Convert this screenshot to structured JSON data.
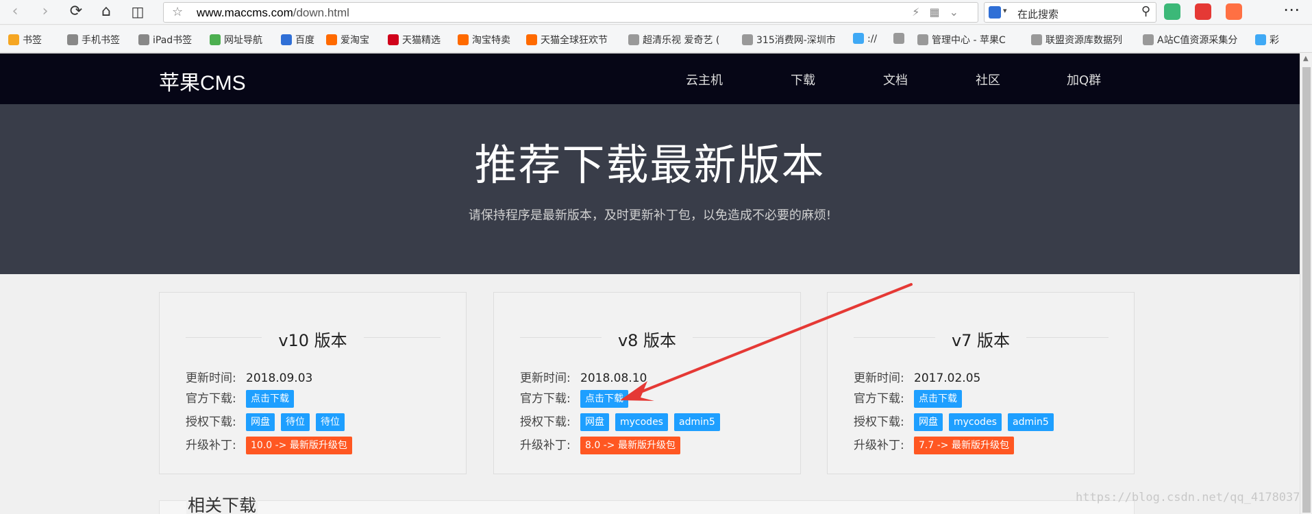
{
  "browser": {
    "url_host": "www.maccms.com",
    "url_path": "/down.html",
    "search_placeholder": "在此搜索",
    "bookmarks": [
      {
        "label": "书签",
        "color": "#f5a623"
      },
      {
        "label": "手机书签",
        "color": "#888888"
      },
      {
        "label": "iPad书签",
        "color": "#888888"
      },
      {
        "label": "网址导航",
        "color": "#4caf50"
      },
      {
        "label": "百度",
        "color": "#2f6fd6"
      },
      {
        "label": "爱淘宝",
        "color": "#ff6a00"
      },
      {
        "label": "天猫精选",
        "color": "#d0021b"
      },
      {
        "label": "淘宝特卖",
        "color": "#ff6a00"
      },
      {
        "label": "天猫全球狂欢节",
        "color": "#ff6a00"
      },
      {
        "label": "超清乐视 爱奇艺 (",
        "color": "#999999"
      },
      {
        "label": "315消费网-深圳市",
        "color": "#999999"
      },
      {
        "label": "://",
        "color": "#3fa9f5"
      },
      {
        "label": "",
        "color": "#999999"
      },
      {
        "label": "管理中心 - 苹果C",
        "color": "#999999"
      },
      {
        "label": "联盟资源库数据列",
        "color": "#999999"
      },
      {
        "label": "A站C值资源采集分",
        "color": "#999999"
      },
      {
        "label": "彩",
        "color": "#3fa9f5"
      }
    ]
  },
  "site": {
    "logo": "苹果CMS",
    "nav": [
      "云主机",
      "下载",
      "文档",
      "社区",
      "加Q群"
    ],
    "hero_title": "推荐下载最新版本",
    "hero_subtitle": "请保持程序是最新版本，及时更新补丁包，以免造成不必要的麻烦!"
  },
  "labels": {
    "update_time": "更新时间:",
    "official_download": "官方下载:",
    "licensed_download": "授权下载:",
    "upgrade_patch": "升级补丁:"
  },
  "cards": [
    {
      "title": "v10 版本",
      "date": "2018.09.03",
      "official_btn": "点击下载",
      "licensed_btns": [
        "网盘",
        "待位",
        "待位"
      ],
      "patch_btn": "10.0 -> 最新版升级包"
    },
    {
      "title": "v8 版本",
      "date": "2018.08.10",
      "official_btn": "点击下载",
      "licensed_btns": [
        "网盘",
        "mycodes",
        "admin5"
      ],
      "patch_btn": "8.0 -> 最新版升级包"
    },
    {
      "title": "v7 版本",
      "date": "2017.02.05",
      "official_btn": "点击下载",
      "licensed_btns": [
        "网盘",
        "mycodes",
        "admin5"
      ],
      "patch_btn": "7.7 -> 最新版升级包"
    }
  ],
  "related_title": "相关下载",
  "watermark": "https://blog.csdn.net/qq_4178037",
  "colors": {
    "header_bg": "#060616",
    "hero_bg": "#393d49",
    "btn_blue": "#1e9fff",
    "btn_red": "#ff5722",
    "annotation_arrow": "#e53935"
  }
}
